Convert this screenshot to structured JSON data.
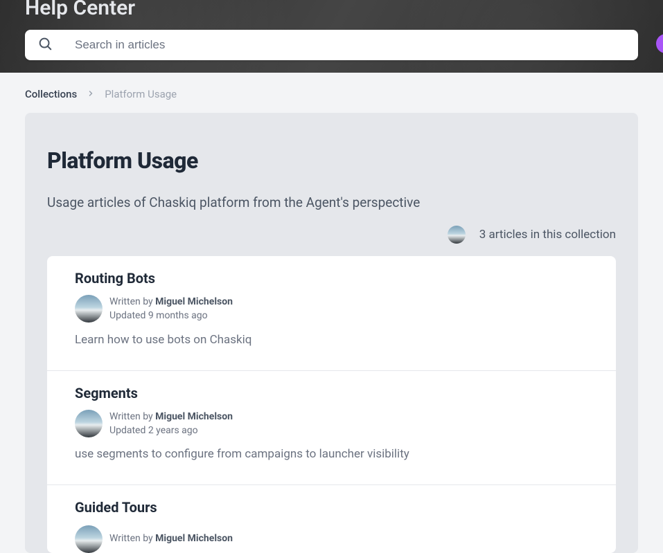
{
  "hero": {
    "title": "Help Center"
  },
  "search": {
    "placeholder": "Search in articles"
  },
  "breadcrumb": {
    "root": "Collections",
    "current": "Platform Usage"
  },
  "page": {
    "title": "Platform Usage",
    "description": "Usage articles of Chaskiq platform from the Agent's perspective",
    "count_text": "3 articles in this collection"
  },
  "articles": [
    {
      "title": "Routing Bots",
      "written_by_prefix": "Written by ",
      "author": "Miguel Michelson",
      "updated": "Updated 9 months ago",
      "description": "Learn how to use bots on Chaskiq"
    },
    {
      "title": "Segments",
      "written_by_prefix": "Written by ",
      "author": "Miguel Michelson",
      "updated": "Updated 2 years ago",
      "description": "use segments to configure from campaigns to launcher visibility"
    },
    {
      "title": "Guided Tours",
      "written_by_prefix": "Written by ",
      "author": "Miguel Michelson",
      "updated": "",
      "description": ""
    }
  ]
}
